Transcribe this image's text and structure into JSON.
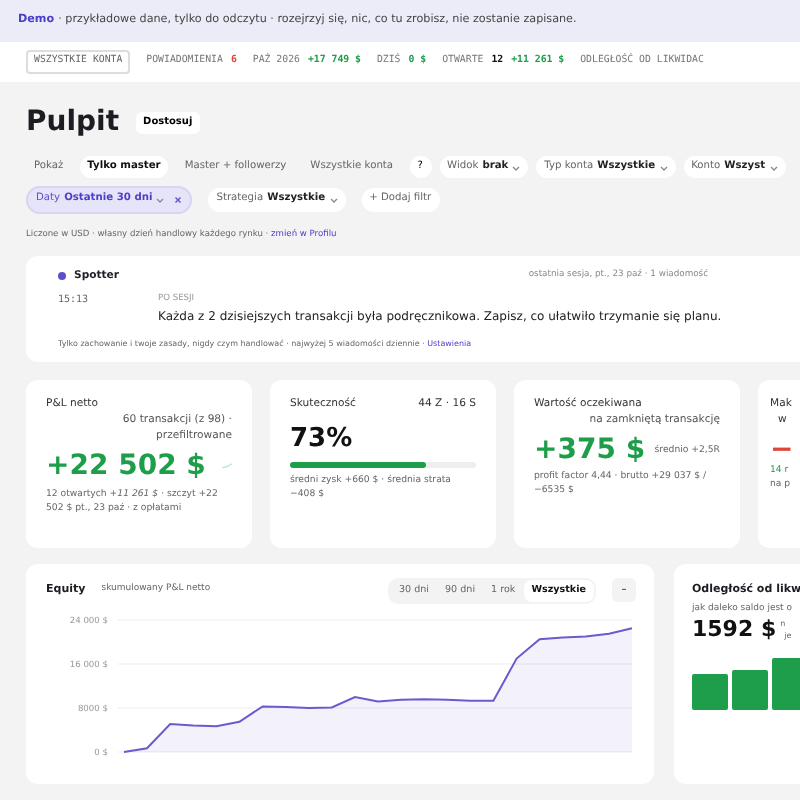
{
  "banner": {
    "brand": "Demo",
    "text": "· przykładowe dane, tylko do odczytu · rozejrzyj się, nic, co tu zrobisz, nie zostanie zapisane."
  },
  "ticker": {
    "scope": "WSZYSTKIE KONTA",
    "items": [
      {
        "label": "POWIADOMIENIA",
        "parts": [
          {
            "text": "6",
            "kind": "alert"
          }
        ]
      },
      {
        "label": "PAŹ 2026",
        "parts": [
          {
            "text": "+17 749 $",
            "kind": "gain"
          }
        ]
      },
      {
        "label": "DZIŚ",
        "parts": [
          {
            "text": "0 $",
            "kind": "gain"
          }
        ]
      },
      {
        "label": "OTWARTE",
        "parts": [
          {
            "text": "12",
            "kind": "count"
          },
          {
            "text": "+11 261 $",
            "kind": "gain"
          }
        ]
      },
      {
        "label": "ODLEGŁOŚĆ OD LIKWIDAC"
      }
    ]
  },
  "page": {
    "title": "Pulpit",
    "customize": "Dostosuj"
  },
  "show": {
    "label": "Pokaż",
    "options": [
      {
        "label": "Tylko master",
        "selected": true
      },
      {
        "label": "Master + followerzy",
        "selected": false
      },
      {
        "label": "Wszystkie konta",
        "selected": false
      }
    ],
    "help": "?"
  },
  "view_filters": [
    {
      "name": "Widok",
      "value": "brak",
      "active": false
    },
    {
      "name": "Typ konta",
      "value": "Wszystkie",
      "active": false
    },
    {
      "name": "Konto",
      "value": "Wszyst",
      "active": false
    }
  ],
  "range_filters": [
    {
      "name": "Daty",
      "value": "Ostatnie 30 dni",
      "active": true
    },
    {
      "name": "Strategia",
      "value": "Wszystkie",
      "active": false
    }
  ],
  "add_filter": "+ Dodaj filtr",
  "note": {
    "text": "Liczone w USD · własny dzień handlowy każdego rynku · ",
    "link": "zmień w Profilu"
  },
  "spotter": {
    "name": "Spotter",
    "meta": "ostatnia sesja, pt., 23 paź · 1 wiadomość",
    "time": "15:13",
    "tag": "PO SESJI",
    "message": "Każda z 2 dzisiejszych transakcji była podręcznikowa. Zapisz, co ułatwiło trzymanie się planu.",
    "footer": "Tylko zachowanie i twoje zasady, nigdy czym handlować · najwyżej 5 wiadomości dziennie · ",
    "footer_link": "Ustawienia"
  },
  "metrics": [
    {
      "kind": "pnl",
      "title": "P&L netto",
      "sub": "60 transakcji (z 98) · przefiltrowane",
      "value": "+22 502 $",
      "note": "12 otwartych *+11 261 $* · szczyt +22 502 $ pt., 23 paź · z opłatami"
    },
    {
      "kind": "rate",
      "title": "Skuteczność",
      "side": "44 Z · 16 S",
      "value": "73%",
      "level": 0.73,
      "note": "średni zysk +660 $ · średnia strata −408 $"
    },
    {
      "kind": "expect",
      "title": "Wartość oczekiwana",
      "sub": "na zamkniętą transakcję",
      "value": "+375 $",
      "side": "średnio +2,5R",
      "note": "profit factor 4,44 · brutto +29 037 $ / −6535 $"
    },
    {
      "kind": "cut",
      "title": "Mak",
      "sub": "w",
      "value": "−",
      "lines": [
        "14 r",
        "na p"
      ]
    }
  ],
  "equity": {
    "title": "Equity",
    "sub": "skumulowany P&L netto",
    "ranges": [
      {
        "label": "30 dni",
        "selected": false
      },
      {
        "label": "90 dni",
        "selected": false
      },
      {
        "label": "1 rok",
        "selected": false
      },
      {
        "label": "Wszystkie",
        "selected": true
      }
    ],
    "collapse": "–",
    "chart_data": {
      "type": "area",
      "ylim": [
        0,
        24000
      ],
      "yticks": [
        {
          "value": 0,
          "label": "0 $"
        },
        {
          "value": 8000,
          "label": "8000 $"
        },
        {
          "value": 16000,
          "label": "16 000 $"
        },
        {
          "value": 24000,
          "label": "24 000 $"
        }
      ],
      "series": [
        {
          "color": "#6a5acd",
          "values": [
            0,
            700,
            5100,
            4800,
            4700,
            5500,
            8300,
            8200,
            8000,
            8100,
            10000,
            9200,
            9500,
            9600,
            9500,
            9300,
            9300,
            17000,
            20500,
            20800,
            21000,
            21500,
            22500
          ]
        }
      ]
    }
  },
  "distance": {
    "title": "Odległość od likw",
    "sub": "jak daleko saldo jest o",
    "value": "1592 $",
    "side": [
      "n",
      "je"
    ]
  }
}
